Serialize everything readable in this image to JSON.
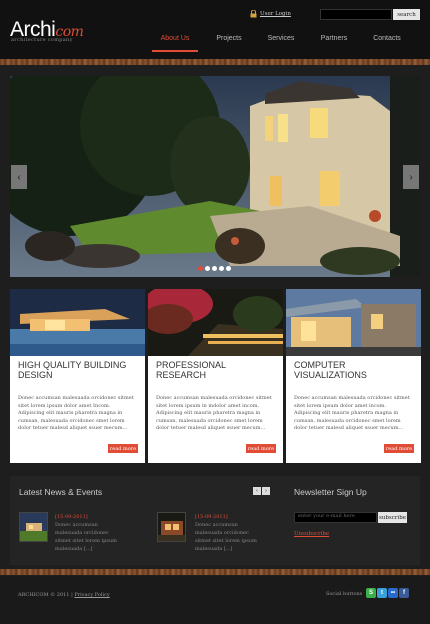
{
  "header": {
    "logo_main": "Archi",
    "logo_accent": "com",
    "tagline": "architecture company",
    "login_label": "User Login",
    "search_label": "search",
    "nav": [
      "About Us",
      "Projects",
      "Services",
      "Partners",
      "Contacts"
    ],
    "active_nav": "About Us"
  },
  "slider": {
    "prev_label": "‹",
    "next_label": "›",
    "dot_count": 5,
    "active_dot": 1
  },
  "cards": [
    {
      "title": "High quality building design",
      "text": "Donec accumsan malesuada orcidonec sitmet sitet lorem ipsum dolor amet Incom. Adipiscing elit mauris pharetra magna in cumsan, malesuada orcidonec smet lorem dolor tetuer malesd aliquet ssuer mecum...",
      "button": "read more"
    },
    {
      "title": "Professional research",
      "text": "Donec accumsan malesuada orcidonec sitmet sitet lorem ipsum in mdolor amet incom. Adipiscing elit mauris pharetra magna in cumsan, malesuada orcidonec smet lorem dolor tetuer malesd aliquet ssuer mecum...",
      "button": "read more"
    },
    {
      "title": "Computer visualizations",
      "text": "Donec accumsan malesuada orcidonec sitmet sitet lorem ipsum dolor amet incom. Adipiscing elit mauris pharetra magna in cumsan, malesuada orcidonec smet lorem dolor tetuer malesd aliquet ssuer mecum...",
      "button": "read more"
    }
  ],
  "news": {
    "title": "Latest News & Events",
    "prev": "‹",
    "next": "›",
    "items": [
      {
        "date": "[15-09-2011]",
        "text": "Donec accumsan malesuada orcidonec sitmet sitet lorem ipsum malesuada [...]"
      },
      {
        "date": "[15-09-2011]",
        "text": "Donec accumsan malesuada orcidonec sitmet sitet lorem ipsum malesuada [...]"
      }
    ]
  },
  "newsletter": {
    "title": "Newsletter Sign Up",
    "placeholder": "enter your e-mail here",
    "subscribe": "subscribe",
    "unsubscribe": "Unsubscribe"
  },
  "footer": {
    "copyright": "ARCHICOM © 2011",
    "separator": "|",
    "privacy": "Privacy Policy",
    "social_label": "Social buttons",
    "social_icons": [
      "skype-icon",
      "twitter-icon",
      "flickr-icon",
      "facebook-icon"
    ]
  },
  "colors": {
    "accent": "#e04c36",
    "background": "#1e1e1e",
    "header": "#111111"
  }
}
